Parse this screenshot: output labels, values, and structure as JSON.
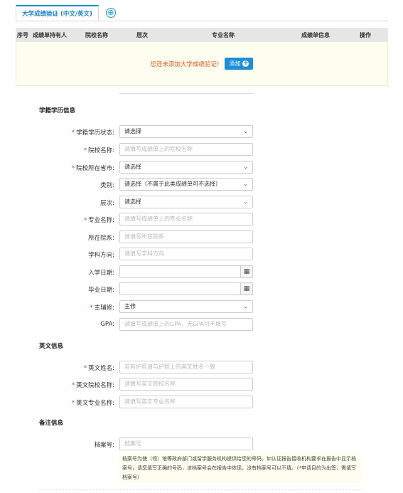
{
  "tabs": {
    "active_label": "大学成绩验证 (中文/英文)",
    "add_icon": "⊕"
  },
  "table": {
    "headers": [
      "序号",
      "成绩单持有人",
      "院校名称",
      "层次",
      "专业名称",
      "成绩单信息",
      "操作"
    ],
    "empty_message": "您还未添加大学成绩验证!",
    "add_button": "添加"
  },
  "sections": {
    "academic": "学籍学历信息",
    "english": "英文信息",
    "remarks": "备注信息"
  },
  "academic_fields": [
    {
      "label": "学籍学历状态:",
      "required": true,
      "type": "select",
      "value": "请选择"
    },
    {
      "label": "院校名称:",
      "required": true,
      "type": "text",
      "placeholder": "请填写成绩单上的院校名称"
    },
    {
      "label": "院校所在省市:",
      "required": true,
      "type": "select",
      "value": "请选择"
    },
    {
      "label": "类别:",
      "required": false,
      "type": "select",
      "value": "请选择（不属于此类成绩单可不选择）"
    },
    {
      "label": "层次:",
      "required": false,
      "type": "select",
      "value": "请选择"
    },
    {
      "label": "专业名称:",
      "required": true,
      "type": "text",
      "placeholder": "请填写成绩单上的专业名称"
    },
    {
      "label": "所在院系:",
      "required": false,
      "type": "text",
      "placeholder": "请填写所在院系"
    },
    {
      "label": "学科方向:",
      "required": false,
      "type": "text",
      "placeholder": "请填写学科方向"
    },
    {
      "label": "入学日期:",
      "required": false,
      "type": "date",
      "placeholder": ""
    },
    {
      "label": "毕业日期:",
      "required": false,
      "type": "date",
      "placeholder": ""
    },
    {
      "label": "主辅修:",
      "required": true,
      "type": "select",
      "value": "主修"
    },
    {
      "label": "GPA:",
      "required": false,
      "type": "text",
      "placeholder": "请填写成绩单上的GPA，无GPA可不填写"
    }
  ],
  "english_fields": [
    {
      "label": "英文姓名:",
      "required": true,
      "placeholder": "若有护照请与护照上的英文姓名一致"
    },
    {
      "label": "英文院校名称:",
      "required": true,
      "placeholder": "请填写英文院校名称"
    },
    {
      "label": "英文专业名称:",
      "required": true,
      "placeholder": "请填写英文专业名称"
    }
  ],
  "remarks_fields": [
    {
      "label": "档案号:",
      "required": false,
      "placeholder": "档案号"
    }
  ],
  "note_text": "档案号为使（领）馆等政府部门或留学服务机构提供给您的号码。如认证报告接收机构要求在报告中显示档案号，请您填写正确的号码，该档案号会在报告中体现，没有档案号可以不填。（*申请目的为出签，需填写档案号）",
  "icons": {
    "chevron": "chevron-down-icon",
    "calendar": "calendar-icon",
    "plus": "plus-circle-icon"
  },
  "colors": {
    "accent": "#1c8fd6",
    "required": "#e0401b",
    "warning_text": "#e0561b"
  }
}
